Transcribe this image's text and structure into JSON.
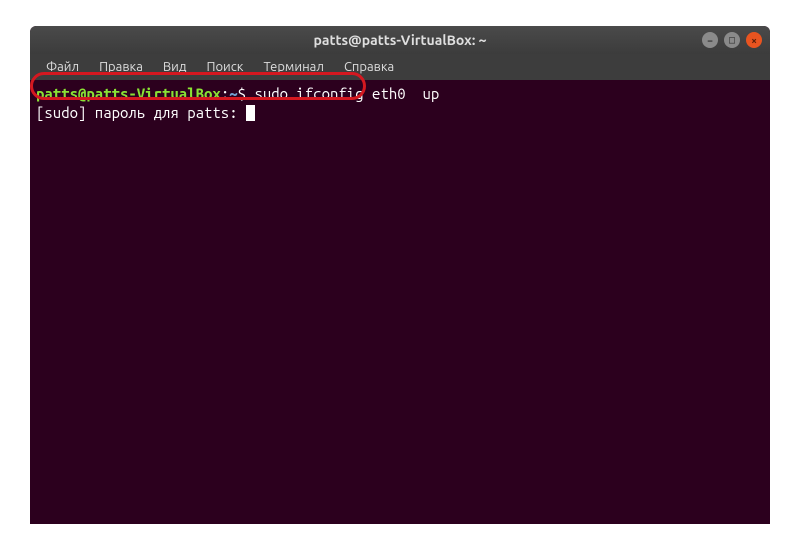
{
  "window": {
    "title": "patts@patts-VirtualBox: ~"
  },
  "window_controls": {
    "minimize": "−",
    "maximize": "□",
    "close": "×"
  },
  "menubar": {
    "file": "Файл",
    "edit": "Правка",
    "view": "Вид",
    "search": "Поиск",
    "terminal": "Терминал",
    "help": "Справка"
  },
  "terminal": {
    "prompt_user": "patts@patts-VirtualBox",
    "prompt_sep": ":",
    "prompt_path": "~",
    "prompt_dollar": "$",
    "command": "sudo ifconfig eth0  up",
    "sudo_prompt": "[sudo] пароль для patts: "
  }
}
